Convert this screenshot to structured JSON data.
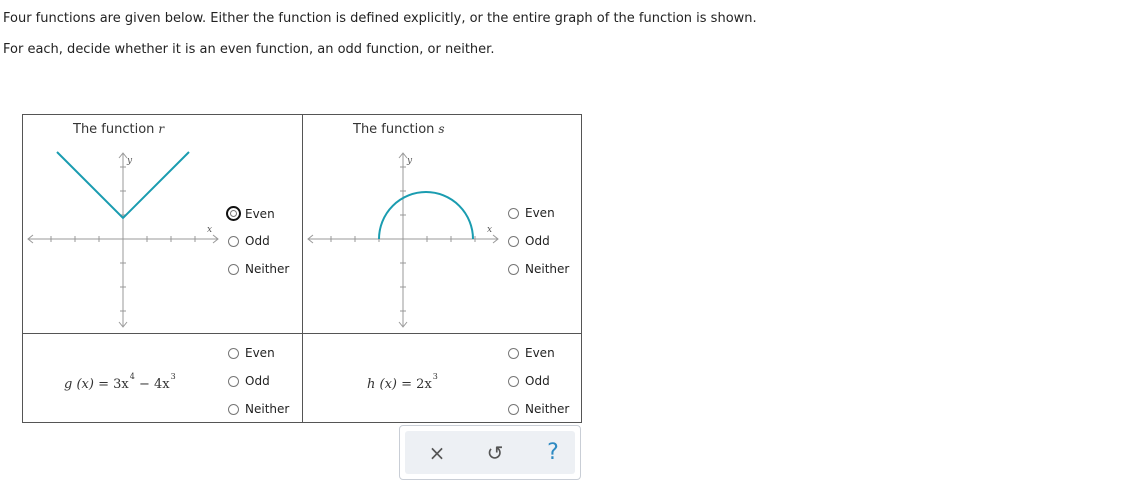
{
  "instructions": {
    "line1": "Four functions are given below. Either the function is defined explicitly, or the entire graph of the function is shown.",
    "line2": "For each, decide whether it is an even function, an odd function, or neither."
  },
  "cells": {
    "r": {
      "title": "The function",
      "name": "r",
      "axis_x": "x",
      "axis_y": "y",
      "options": [
        "Even",
        "Odd",
        "Neither"
      ],
      "focused_option": "Even"
    },
    "s": {
      "title": "The function",
      "name": "s",
      "axis_x": "x",
      "axis_y": "y",
      "options": [
        "Even",
        "Odd",
        "Neither"
      ]
    },
    "g": {
      "lhs": "g (x)",
      "eq": "=",
      "rhs_a": "3x",
      "exp_a": "4",
      "minus": "−",
      "rhs_b": "4x",
      "exp_b": "3",
      "options": [
        "Even",
        "Odd",
        "Neither"
      ]
    },
    "h": {
      "lhs": "h (x)",
      "eq": "=",
      "rhs": "2x",
      "exp": "3",
      "options": [
        "Even",
        "Odd",
        "Neither"
      ]
    }
  },
  "toolbar": {
    "clear": "×",
    "undo": "↺",
    "help": "?"
  },
  "colors": {
    "curve": "#1a9cb0",
    "axis": "#999999",
    "grid_border": "#555555",
    "help": "#2e8ac2"
  }
}
